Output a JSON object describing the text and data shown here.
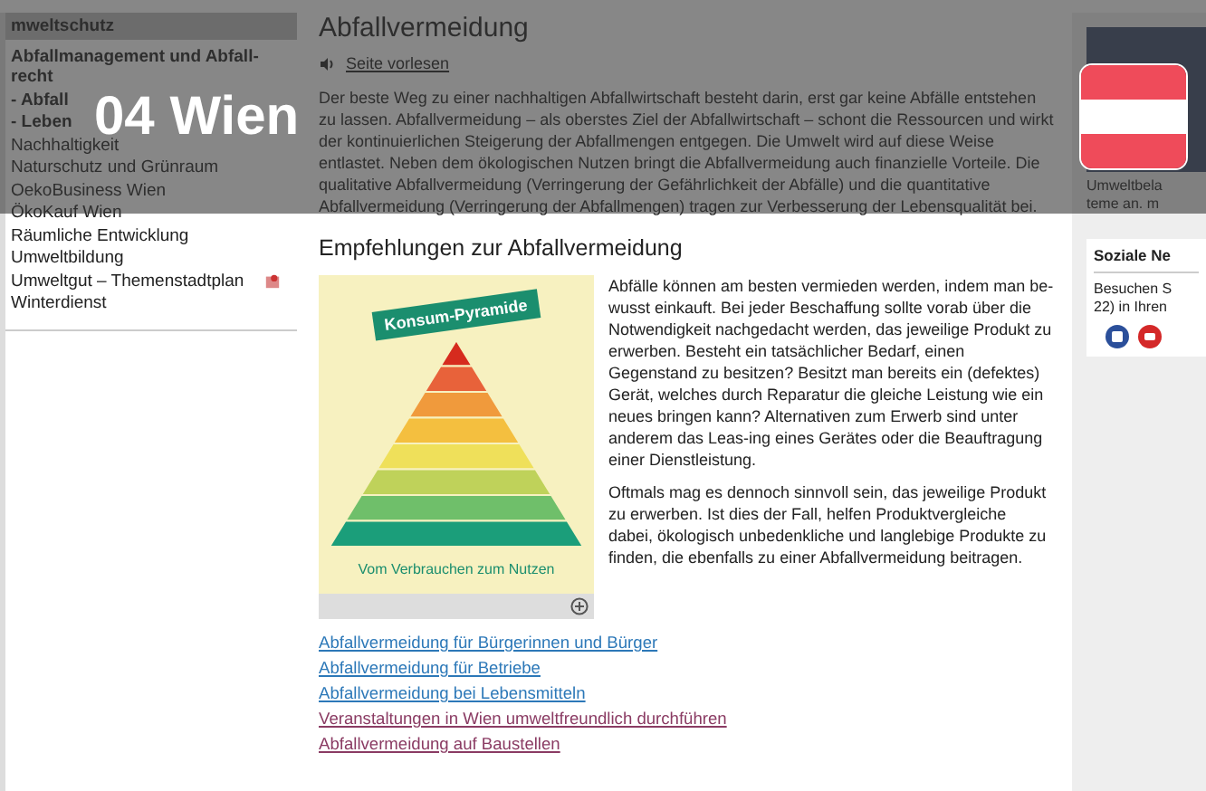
{
  "overlay": {
    "title": "04 Wien"
  },
  "sidebar": {
    "section": "mweltschutz",
    "items": [
      {
        "label": "Abfallmanagement und Abfall-recht",
        "kind": "parent",
        "children": [
          {
            "label": "- Abfall",
            "kind": "sub"
          },
          {
            "label": "- Leben",
            "kind": "sub"
          }
        ]
      },
      {
        "label": "Nachhaltigkeit",
        "kind": "plain"
      },
      {
        "label": "Naturschutz und Grünraum",
        "kind": "plain"
      },
      {
        "label": "OekoBusiness Wien",
        "kind": "plain"
      },
      {
        "label": "ÖkoKauf Wien",
        "kind": "plain"
      },
      {
        "label": "Räumliche Entwicklung",
        "kind": "plain"
      },
      {
        "label": "Umweltbildung",
        "kind": "plain"
      },
      {
        "label": "Umweltgut – Themenstadtplan",
        "kind": "map"
      },
      {
        "label": "Winterdienst",
        "kind": "plain"
      }
    ]
  },
  "main": {
    "title": "Abfallvermeidung",
    "read_aloud": "Seite vorlesen",
    "intro": "Der beste Weg zu einer nachhaltigen Abfallwirtschaft besteht darin, erst gar keine Abfälle entstehen zu lassen. Abfallvermeidung – als oberstes Ziel der Abfallwirtschaft – schont die Ressourcen und wirkt der kontinuierlichen Steigerung der Abfallmengen entgegen. Die Umwelt wird auf diese Weise entlastet. Neben dem ökologischen Nutzen bringt die Abfallvermeidung auch finanzielle Vorteile. Die qualitative Abfallvermeidung (Verringerung der Gefährlichkeit der Abfälle) und die quantitative Abfallvermeidung (Verringerung der Abfallmengen) tragen zur Verbesserung der Lebensqualität bei.",
    "subtitle": "Empfehlungen zur Abfallvermeidung",
    "figure": {
      "title": "Konsum-Pyramide",
      "caption": "Vom Verbrauchen zum Nutzen"
    },
    "paragraphs": [
      "Abfälle können am besten vermieden werden, indem man be-wusst einkauft. Bei jeder Beschaffung sollte vorab über die Notwendigkeit nachgedacht werden, das jeweilige Produkt zu erwerben. Besteht ein tatsächlicher Bedarf, einen Gegenstand zu besitzen? Besitzt man bereits ein (defektes) Gerät, welches durch Reparatur die gleiche Leistung wie ein neues bringen kann? Alternativen zum Erwerb sind unter anderem das Leas-ing eines Gerätes oder die Beauftragung einer Dienstleistung.",
      "Oftmals mag es dennoch sinnvoll sein, das jeweilige Produkt zu erwerben. Ist dies der Fall, helfen Produktvergleiche dabei, ökologisch unbedenkliche und langlebige Produkte zu finden, die ebenfalls zu einer Abfallvermeidung beitragen."
    ],
    "links": [
      {
        "label": "Abfallvermeidung für Bürgerinnen und Bürger",
        "visited": false
      },
      {
        "label": "Abfallvermeidung für Betriebe",
        "visited": false
      },
      {
        "label": "Abfallvermeidung bei Lebensmitteln",
        "visited": false
      },
      {
        "label": "Veranstaltungen in Wien umweltfreundlich durchführen",
        "visited": true
      },
      {
        "label": "Abfallvermeidung auf Baustellen",
        "visited": true
      }
    ]
  },
  "aside": {
    "caption": [
      "Umweltbela",
      "teme an. m"
    ],
    "social": {
      "title": "Soziale Ne",
      "text": [
        "Besuchen S",
        "22) in Ihren"
      ]
    }
  }
}
